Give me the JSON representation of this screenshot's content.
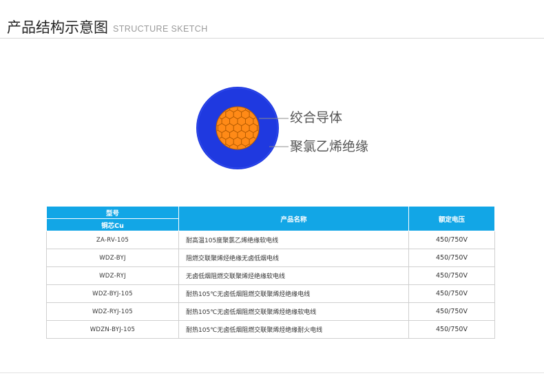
{
  "header": {
    "title_cn": "产品结构示意图",
    "title_en": "STRUCTURE SKETCH"
  },
  "sketch": {
    "labels": {
      "conductor": "绞合导体",
      "insulation": "聚氯乙烯绝缘"
    },
    "colors": {
      "insulation": "#1f39e0",
      "conductor": "#ff8a17",
      "strand_outline": "#b35a00"
    }
  },
  "table": {
    "headers": {
      "model": "型号",
      "conductor": "铜芯Cu",
      "product_name": "产品名称",
      "rated_voltage": "额定电压"
    },
    "rows": [
      {
        "model": "ZA-RV-105",
        "name": "耐高温105度聚氯乙烯绝缘软电线",
        "voltage": "450/750V"
      },
      {
        "model": "WDZ-BYJ",
        "name": "阻燃交联聚烯烃绝缘无卤低烟电线",
        "voltage": "450/750V"
      },
      {
        "model": "WDZ-RYJ",
        "name": "无卤低烟阻燃交联聚烯烃绝缘软电线",
        "voltage": "450/750V"
      },
      {
        "model": "WDZ-BYJ-105",
        "name": "耐热105℃无卤低烟阻燃交联聚烯烃绝缘电线",
        "voltage": "450/750V"
      },
      {
        "model": "WDZ-RYJ-105",
        "name": "耐热105℃无卤低烟阻燃交联聚烯烃绝缘软电线",
        "voltage": "450/750V"
      },
      {
        "model": "WDZN-BYJ-105",
        "name": "耐热105℃无卤低烟阻燃交联聚烯烃绝缘耐火电线",
        "voltage": "450/750V"
      }
    ],
    "colors": {
      "header_bg": "#12a6e6",
      "header_text": "#ffffff"
    }
  }
}
